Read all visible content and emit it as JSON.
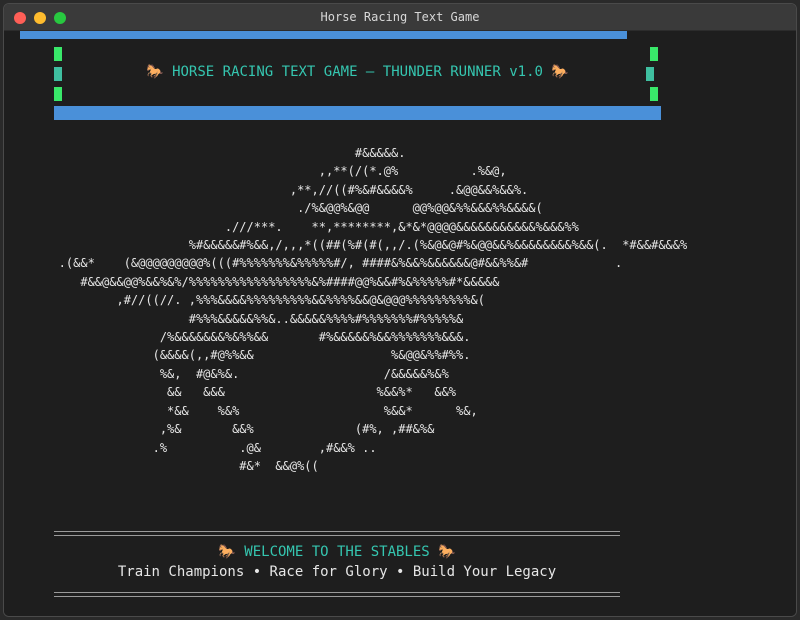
{
  "window": {
    "title": "Horse Racing Text Game"
  },
  "header": {
    "title": "🐎 HORSE RACING TEXT GAME – THUNDER RUNNER v1.0 🐎"
  },
  "art": {
    "lines": "                                            #&&&&&.\n                                       ,,**(/(*.@%          .%&@,\n                                   ,**,//((#%&#&&&&%     .&@@&&%&&%.\n                                    ./%&@@%&@@      @@%@@&%%&&&%%&&&&(\n                          .///***.    **,********,&*&*@@@@&&&&&&&&&&&%&&&%%\n                     %#&&&&&#%&&,/,,,*((##(%#(#(,,/.(%&@&@#%&@@&&%&&&&&&&&%&&(.  *#&&#&&&%\n   .(&&*    (&@@@@@@@@@%(((#%%%%%%%&%%%%%#/, ####&%&&%&&&&&&@#&&%%&#            .\n      #&&@&&@@%&&%&%/%%%%%%%%%%%%%%%%%&%####@@%&&#%&%%%%%#*&&&&&\n           ,#//((//. ,%%%&&&&%%%%%%%%%&&%%%%&&@&@@@%%%%%%%%%&(\n                     #%%%&&&&&%%&..&&&&&%%%%#%%%%%%%#%%%%%&\n                 /%&&&&&&&%&%%&&       #%&&&&&%&&%%%%%%%&&&.\n                (&&&&(,,#@%%&&                   %&@@&%%#%%.\n                 %&,  #@&%&.                    /&&&&&%&%\n                  &&   &&&                     %&&%*   &&%\n                  *&&    %&%                    %&&*      %&,\n                 ,%&       &&%              (#%, ,##&%&\n                .%          .@&        ,#&&% ..\n                            #&*  &&@%(("
  },
  "footer": {
    "welcome": "🐎 WELCOME TO THE STABLES 🐎",
    "tagline": "Train Champions • Race for Glory • Build Your Legacy"
  },
  "colors": {
    "accent_blue": "#4a90d9",
    "accent_teal": "#35c6b0",
    "accent_green": "#39e86a",
    "background": "#1e1e1e",
    "text": "#e6e6e6"
  }
}
